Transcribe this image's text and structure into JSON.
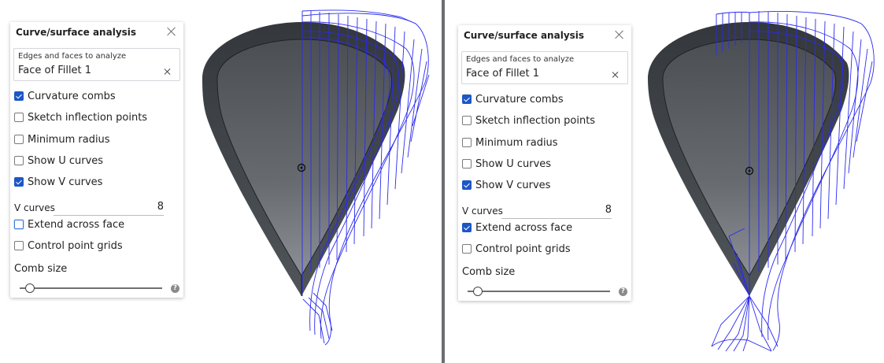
{
  "panels": [
    {
      "title": "Curve/surface analysis",
      "selection": {
        "label": "Edges and faces to analyze",
        "value": "Face of Fillet 1"
      },
      "options": {
        "curvature_combs": {
          "label": "Curvature combs",
          "checked": true
        },
        "sketch_inflection": {
          "label": "Sketch inflection points",
          "checked": false
        },
        "minimum_radius": {
          "label": "Minimum radius",
          "checked": false
        },
        "show_u_curves": {
          "label": "Show U curves",
          "checked": false
        },
        "show_v_curves": {
          "label": "Show V curves",
          "checked": true
        },
        "extend_across_face": {
          "label": "Extend across face",
          "checked": false,
          "focused": true
        },
        "control_point_grids": {
          "label": "Control point grids",
          "checked": false
        }
      },
      "v_curves": {
        "label": "V curves",
        "value": "8"
      },
      "comb_size": {
        "label": "Comb size",
        "level": 0.04
      },
      "help_glyph": "?"
    },
    {
      "title": "Curve/surface analysis",
      "selection": {
        "label": "Edges and faces to analyze",
        "value": "Face of Fillet 1"
      },
      "options": {
        "curvature_combs": {
          "label": "Curvature combs",
          "checked": true
        },
        "sketch_inflection": {
          "label": "Sketch inflection points",
          "checked": false
        },
        "minimum_radius": {
          "label": "Minimum radius",
          "checked": false
        },
        "show_u_curves": {
          "label": "Show U curves",
          "checked": false
        },
        "show_v_curves": {
          "label": "Show V curves",
          "checked": true
        },
        "extend_across_face": {
          "label": "Extend across face",
          "checked": true,
          "focused": false
        },
        "control_point_grids": {
          "label": "Control point grids",
          "checked": false
        }
      },
      "v_curves": {
        "label": "V curves",
        "value": "8"
      },
      "comb_size": {
        "label": "Comb size",
        "level": 0.04
      },
      "help_glyph": "?"
    }
  ],
  "colors": {
    "accent": "#1d57c6",
    "comb": "#2a2af0",
    "model_dark": "#3f4348",
    "model_light": "#8c9096",
    "divider": "#6b6e72"
  }
}
